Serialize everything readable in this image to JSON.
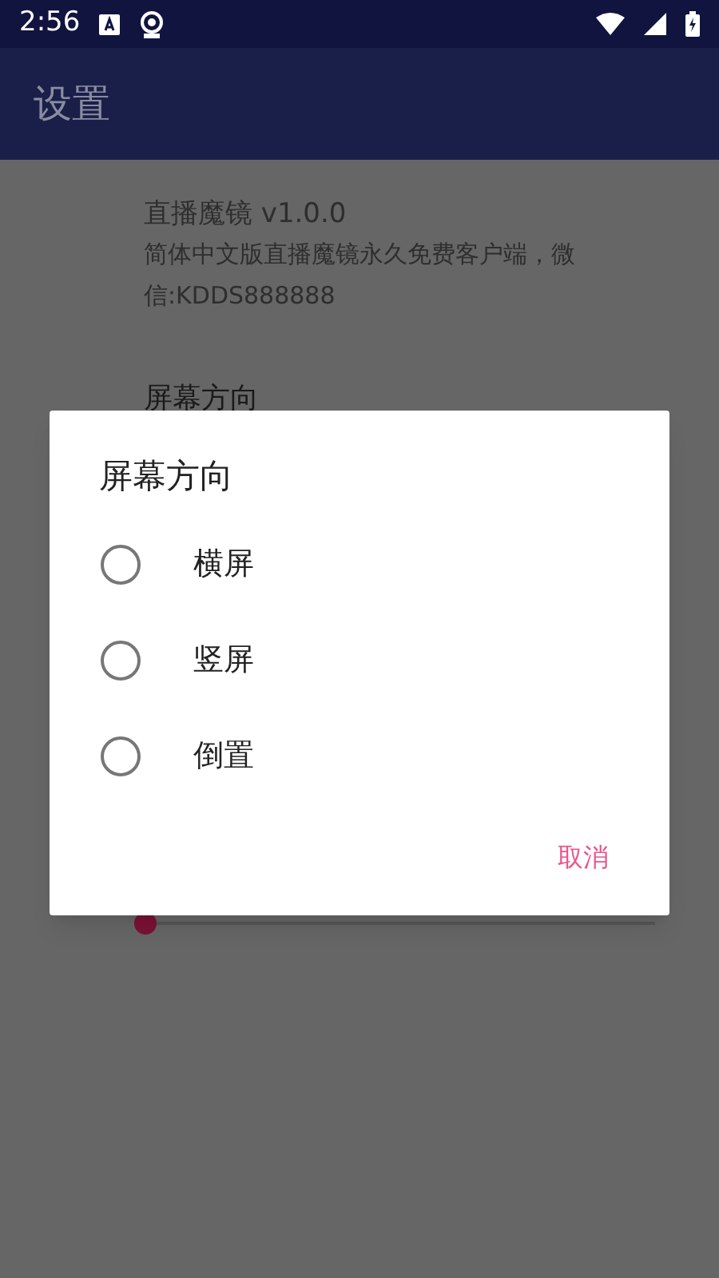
{
  "status_bar": {
    "time": "2:56"
  },
  "app_bar": {
    "title": "设置"
  },
  "preferences": [
    {
      "kind": "info",
      "title": "直播魔镜 v1.0.0",
      "summary": "简体中文版直播魔镜永久免费客户端，微信:KDDS888888"
    },
    {
      "kind": "header",
      "title": "屏幕方向"
    },
    {
      "kind": "slider",
      "level": 0
    }
  ],
  "dialog": {
    "title": "屏幕方向",
    "options": [
      {
        "label": "横屏",
        "selected": false
      },
      {
        "label": "竖屏",
        "selected": false
      },
      {
        "label": "倒置",
        "selected": false
      }
    ],
    "buttons": [
      "取消"
    ]
  }
}
